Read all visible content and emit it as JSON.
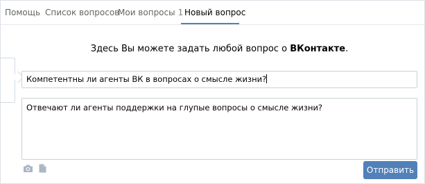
{
  "tabs": [
    {
      "label": "Помощь"
    },
    {
      "label": "Список вопросов"
    },
    {
      "label": "Мои вопросы",
      "count": "1"
    },
    {
      "label": "Новый вопрос",
      "active": true
    }
  ],
  "headline": {
    "text": "Здесь Вы можете задать любой вопрос о ",
    "brand": "ВКонтакте",
    "end": "."
  },
  "question": {
    "title_value": "Компетентны ли агенты ВК в вопросах о смысле жизни?",
    "body_value": "Отвечают ли агенты поддержки на глупые вопросы о смысле жизни?"
  },
  "attachments": {
    "photo_icon": "camera-icon",
    "document_icon": "document-icon"
  },
  "actions": {
    "send_label": "Отправить"
  },
  "colors": {
    "accent": "#5181b8",
    "border": "#c9d0d6",
    "tab_text": "#656565"
  }
}
